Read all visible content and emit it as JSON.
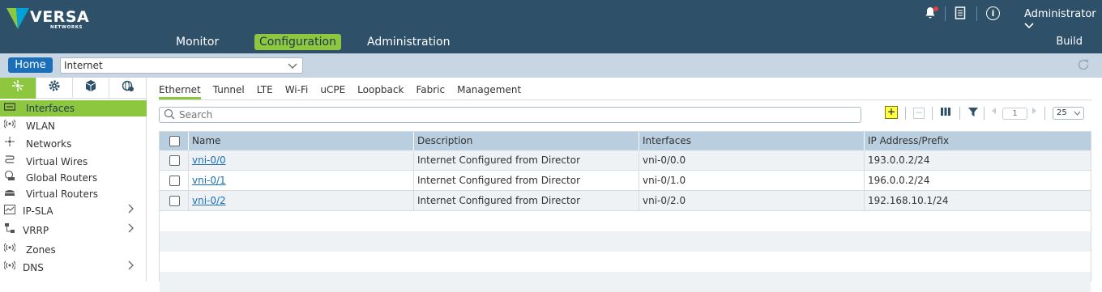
{
  "header": {
    "logo_text": "VERSA",
    "logo_sub": "NETWORKS",
    "nav": [
      {
        "label": "Monitor",
        "active": false
      },
      {
        "label": "Configuration",
        "active": true
      },
      {
        "label": "Administration",
        "active": false
      }
    ],
    "build_label": "Build",
    "user_label": "Administrator",
    "info_glyph": "i",
    "colors": {
      "header_bg": "#2e5068",
      "accent": "#8dc63f",
      "notification": "#e63c3c"
    }
  },
  "subbar": {
    "home_label": "Home",
    "org_value": "Internet"
  },
  "sidebar": {
    "tabs": [
      {
        "icon": "network-icon",
        "active": true
      },
      {
        "icon": "gear-icon",
        "active": false
      },
      {
        "icon": "cube-icon",
        "active": false
      },
      {
        "icon": "globe-settings-icon",
        "active": false
      }
    ],
    "items": [
      {
        "label": "Interfaces",
        "icon": "interface-icon",
        "active": true,
        "expandable": false
      },
      {
        "label": "WLAN",
        "icon": "wireless-icon",
        "active": false,
        "expandable": false
      },
      {
        "label": "Networks",
        "icon": "network-icon",
        "active": false,
        "expandable": false
      },
      {
        "label": "Virtual Wires",
        "icon": "wire-icon",
        "active": false,
        "expandable": false
      },
      {
        "label": "Global Routers",
        "icon": "router-icon",
        "active": false,
        "expandable": false
      },
      {
        "label": "Virtual Routers",
        "icon": "virtual-router-icon",
        "active": false,
        "expandable": false
      },
      {
        "label": "IP-SLA",
        "icon": "chart-icon",
        "active": false,
        "expandable": true
      },
      {
        "label": "VRRP",
        "icon": "vrrp-icon",
        "active": false,
        "expandable": true
      },
      {
        "label": "Zones",
        "icon": "zones-icon",
        "active": false,
        "expandable": false
      },
      {
        "label": "DNS",
        "icon": "dns-icon",
        "active": false,
        "expandable": true
      }
    ]
  },
  "main": {
    "tabs": [
      "Ethernet",
      "Tunnel",
      "LTE",
      "Wi-Fi",
      "uCPE",
      "Loopback",
      "Fabric",
      "Management"
    ],
    "active_tab": "Ethernet",
    "search_placeholder": "Search",
    "pagination": {
      "page": "1",
      "page_size": "25"
    },
    "table": {
      "columns": [
        "Name",
        "Description",
        "Interfaces",
        "IP Address/Prefix"
      ],
      "rows": [
        {
          "name": "vni-0/0",
          "description": "Internet Configured from Director",
          "interfaces": "vni-0/0.0",
          "ip": "193.0.0.2/24"
        },
        {
          "name": "vni-0/1",
          "description": "Internet Configured from Director",
          "interfaces": "vni-0/1.0",
          "ip": "196.0.0.2/24"
        },
        {
          "name": "vni-0/2",
          "description": "Internet Configured from Director",
          "interfaces": "vni-0/2.0",
          "ip": "192.168.10.1/24"
        }
      ]
    }
  }
}
